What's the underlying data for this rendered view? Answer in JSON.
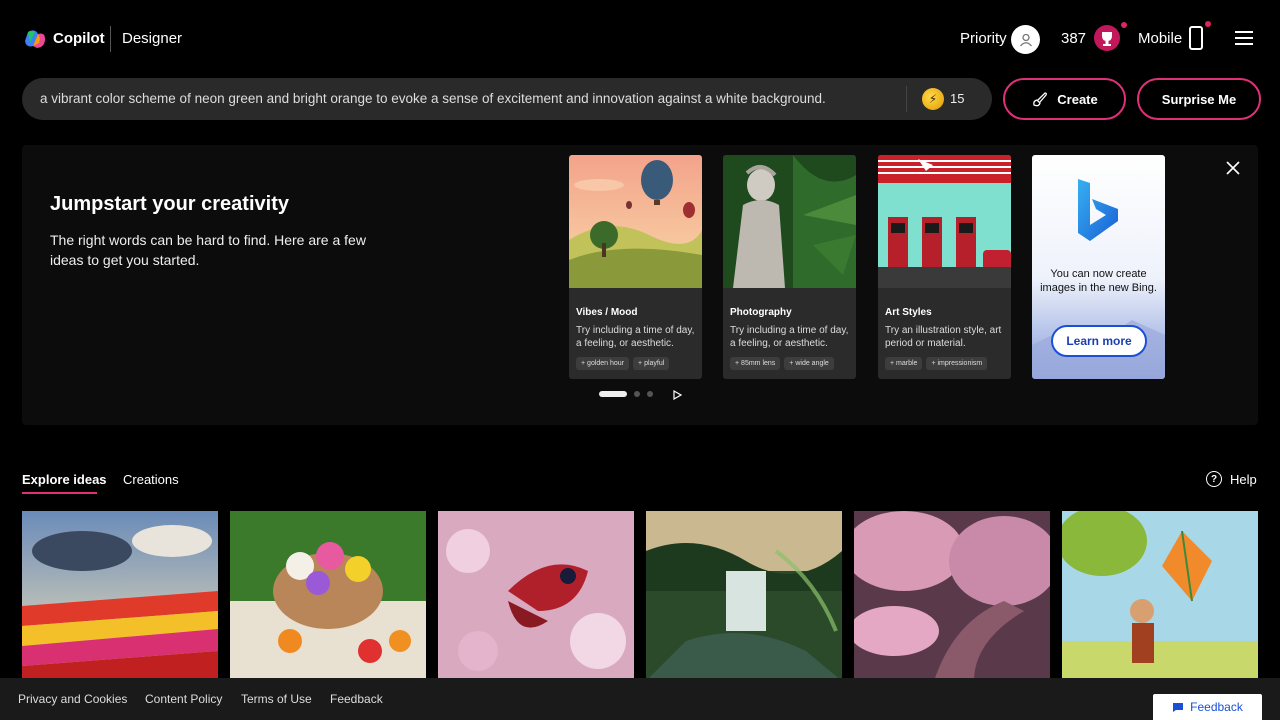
{
  "header": {
    "brand": "Copilot",
    "product": "Designer",
    "priority_label": "Priority",
    "points": "387",
    "mobile_label": "Mobile"
  },
  "prompt": {
    "value": "a vibrant color scheme of neon green and bright orange to evoke a sense of excitement and innovation against a white background.",
    "boosts": "15"
  },
  "actions": {
    "create_label": "Create",
    "surprise_label": "Surprise Me"
  },
  "jumpstart": {
    "title": "Jumpstart your creativity",
    "description": "The right words can be hard to find. Here are a few ideas to get you started.",
    "cards": [
      {
        "title": "Vibes / Mood",
        "text": "Try including a time of day, a feeling, or aesthetic.",
        "chips": [
          "golden hour",
          "playful"
        ]
      },
      {
        "title": "Photography",
        "text": "Try including a time of day, a feeling, or aesthetic.",
        "chips": [
          "85mm lens",
          "wide angle"
        ]
      },
      {
        "title": "Art Styles",
        "text": "Try an illustration style, art period or material.",
        "chips": [
          "marble",
          "impressionism"
        ]
      }
    ],
    "bing_card": {
      "text": "You can now create images in the new Bing.",
      "button": "Learn more"
    }
  },
  "tabs": {
    "explore": "Explore ideas",
    "creations": "Creations",
    "help": "Help"
  },
  "footer": {
    "links": [
      "Privacy and Cookies",
      "Content Policy",
      "Terms of Use",
      "Feedback"
    ],
    "feedback_button": "Feedback"
  },
  "colors": {
    "accent": "#e0307a",
    "bing_blue": "#1a4fd6"
  }
}
